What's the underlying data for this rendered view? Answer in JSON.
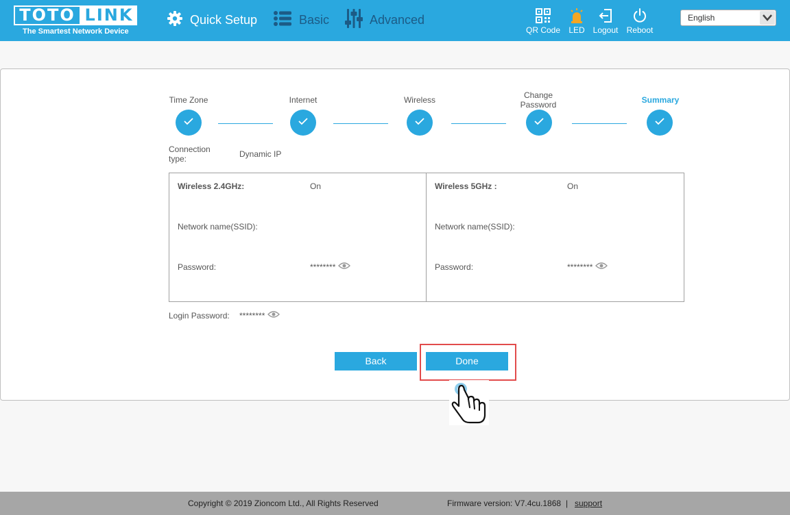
{
  "header": {
    "logo_left": "TOTO",
    "logo_right": "LINK",
    "tagline": "The Smartest Network Device",
    "nav": {
      "quick_setup": "Quick Setup",
      "basic": "Basic",
      "advanced": "Advanced"
    },
    "tools": {
      "qr_code": "QR Code",
      "led": "LED",
      "logout": "Logout",
      "reboot": "Reboot"
    },
    "language": "English"
  },
  "steps": [
    {
      "label": "Time Zone",
      "done": true
    },
    {
      "label": "Internet",
      "done": true
    },
    {
      "label": "Wireless",
      "done": true
    },
    {
      "label": "Change Password",
      "done": true
    },
    {
      "label": "Summary",
      "done": true,
      "active": true
    }
  ],
  "connection": {
    "label": "Connection type:",
    "value": "Dynamic IP"
  },
  "wireless_24": {
    "title": "Wireless 2.4GHz:",
    "status": "On",
    "ssid_label": "Network name(SSID):",
    "password_label": "Password:",
    "password_value": "********"
  },
  "wireless_5": {
    "title": "Wireless 5GHz :",
    "status": "On",
    "ssid_label": "Network name(SSID):",
    "password_label": "Password:",
    "password_value": "********"
  },
  "login": {
    "label": "Login Password:",
    "value": "********"
  },
  "buttons": {
    "back": "Back",
    "done": "Done"
  },
  "footer": {
    "copyright": "Copyright © 2019 Zioncom Ltd., All Rights Reserved",
    "firmware": "Firmware version: V7.4cu.1868",
    "separator": "|",
    "support": "support"
  },
  "colors": {
    "header_bg": "#2aa8df",
    "accent": "#2aa8df",
    "nav_inactive": "#1c5b86",
    "highlight": "#e24b4b",
    "led_active": "#f5a623",
    "footer_bg": "#a6a6a6"
  },
  "icons": {
    "quick_setup": "gear-icon",
    "basic": "list-icon",
    "advanced": "sliders-icon",
    "qr_code": "qr-code-icon",
    "led": "led-bulb-icon",
    "logout": "logout-icon",
    "reboot": "power-icon",
    "language_dropdown": "chevron-down-icon",
    "step_done": "checkmark-icon",
    "password_reveal": "eye-icon",
    "pointer": "hand-pointer-icon"
  }
}
